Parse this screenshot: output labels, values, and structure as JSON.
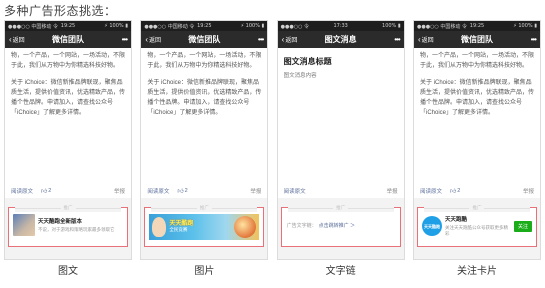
{
  "page_title": "多种广告形态挑选：",
  "phones": [
    {
      "status": {
        "carrier": "●●●○○ 中国移动 令",
        "time": "19:25",
        "battery": "⚡ 100% ▮"
      },
      "nav": {
        "back": "返回",
        "title": "微信团队",
        "more": "•••"
      },
      "para1": "物，一个产品，一个网站，一场活动，不限于此，我们从万物中为你精选科技好物。",
      "para2": "关于 iChoice：微信新推品牌联现，聚焦品质生活，提供价值资讯，优选精致产品，传播个性品牌。申请加入，请查找公众号「iChoice」了解更多详情。",
      "read_more": "阅读原文",
      "likes": "2",
      "report": "举报",
      "ad_label": "推广",
      "ad": {
        "title": "天天酷跑全新版本",
        "desc": "不说，对于游戏和策略玩家最多领取它"
      },
      "caption": "图文"
    },
    {
      "status": {
        "carrier": "●●●○○ 中国移动 令",
        "time": "19:25",
        "battery": "⚡ 100% ▮"
      },
      "nav": {
        "back": "返回",
        "title": "微信团队",
        "more": "•••"
      },
      "para1": "物，一个产品，一个网站，一场活动，不限于此，我们从万物中为你精选科技好物。",
      "para2": "关于 iChoice：微信新推品牌联现，聚焦品质生活，提供价值资讯，优选精致产品，传播个性品牌。申请加入，请查找公众号「iChoice」了解更多详情。",
      "read_more": "阅读原文",
      "likes": "2",
      "report": "举报",
      "ad_label": "推广",
      "ad": {
        "title": "天天酷跑",
        "subtitle": "全民竞赛"
      },
      "caption": "图片"
    },
    {
      "status": {
        "carrier": "●●●○○ 令",
        "time": "17:33",
        "battery": "100% ▮"
      },
      "nav": {
        "back": "返回",
        "title": "图文消息",
        "more": "•••"
      },
      "article_title": "图文消息标题",
      "article_sub": "图文消息内容",
      "read_more": "阅读原文",
      "report": "举报",
      "ad_label": "推广",
      "ad": {
        "prefix": "广告文字链：",
        "link": "点击跳转推广 ＞"
      },
      "caption": "文字链"
    },
    {
      "status": {
        "carrier": "●●●○○ 中国移动 令",
        "time": "19:25",
        "battery": "⚡ 100% ▮"
      },
      "nav": {
        "back": "返回",
        "title": "微信团队",
        "more": "•••"
      },
      "para1": "物，一个产品，一个网站，一场活动，不限于此，我们从万物中为你精选科技好物。",
      "para2": "关于 iChoice：微信新推品牌联现，聚焦品质生活，提供价值资讯，优选精致产品，传播个性品牌。申请加入，请查找公众号「iChoice」了解更多详情。",
      "read_more": "阅读原文",
      "likes": "2",
      "report": "举报",
      "ad_label": "推广",
      "ad": {
        "logo": "天天酷跑",
        "title": "天天跑酷",
        "desc": "关注天天跑酷公众号获取更多精彩",
        "follow": "关注"
      },
      "caption": "关注卡片"
    }
  ],
  "colors": {
    "ad_border": "#e8707a",
    "follow_button": "#1aad19",
    "nav_bg": "#2b2b2b"
  },
  "icons": {
    "back": "chevron-left-icon",
    "more": "more-dots-icon",
    "like": "thumbs-up-icon"
  }
}
